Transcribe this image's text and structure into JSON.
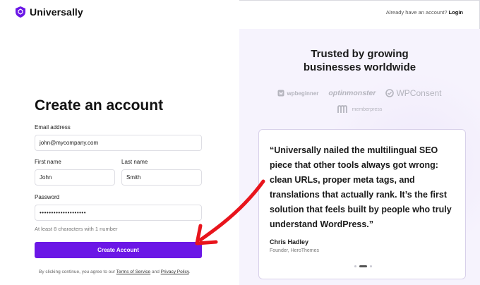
{
  "brand": {
    "name": "Universally",
    "logo_icon": "shield-logo-icon",
    "accent": "#6b17e6"
  },
  "header": {
    "prompt": "Already have an account?",
    "login_label": "Login"
  },
  "form": {
    "title": "Create an account",
    "email": {
      "label": "Email address",
      "value": "john@mycompany.com"
    },
    "first_name": {
      "label": "First name",
      "value": "John"
    },
    "last_name": {
      "label": "Last name",
      "value": "Smith"
    },
    "password": {
      "label": "Password",
      "value": "••••••••••••••••••••",
      "hint": "At least 8 characters with 1 number"
    },
    "submit_label": "Create Account",
    "legal": {
      "prefix": "By clicking continue, you agree to our",
      "terms": "Terms of Service",
      "and": "and",
      "privacy": "Privacy Policy",
      "suffix": "."
    }
  },
  "promo": {
    "heading_line1": "Trusted by growing",
    "heading_line2": "businesses worldwide",
    "logos": [
      "wpbeginner",
      "optinmonster",
      "WPConsent",
      "memberpress"
    ],
    "testimonial": {
      "quote": "“Universally nailed the multilingual SEO piece that other tools always got wrong: clean URLs, proper meta tags, and translations that actually rank. It’s the first solution that feels built by people who truly understand WordPress.”",
      "author": "Chris Hadley",
      "role": "Founder, HeroThemes"
    },
    "carousel": {
      "count": 3,
      "active": 2
    }
  },
  "annotation": {
    "arrow_color": "#e8141c"
  }
}
